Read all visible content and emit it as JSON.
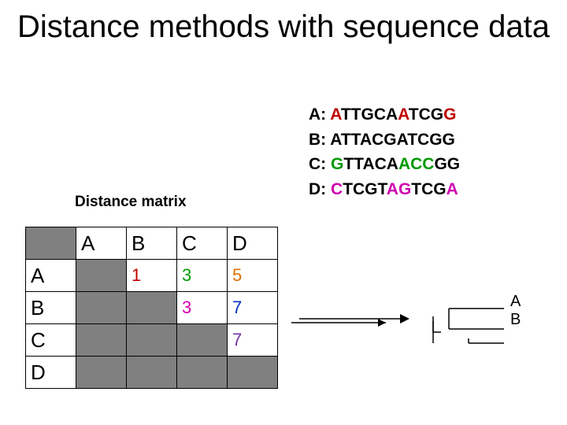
{
  "title": "Distance methods with sequence data",
  "sequences": {
    "A": {
      "label": "A:",
      "pre": "A",
      "mid1": "TTGCA",
      "mut1": "A",
      "post1": "TCG",
      "mut2": "G",
      "post2": ""
    },
    "B": {
      "label": "B:",
      "text": "ATTACGATCGG"
    },
    "C": {
      "label": "C:",
      "pre": "G",
      "mid": "TTACA",
      "mut": "ACC",
      "post": "GG"
    },
    "D": {
      "label": "D:",
      "pre": "C",
      "mid1": "TCGT",
      "mut1": "AG",
      "mid2": "TCG",
      "mut2": "A"
    }
  },
  "matrix_label": "Distance matrix",
  "matrix": {
    "headers": [
      "A",
      "B",
      "C",
      "D"
    ],
    "rows": [
      "A",
      "B",
      "C",
      "D"
    ],
    "cells": {
      "AB": "1",
      "AC": "3",
      "AD": "5",
      "BC": "3",
      "BD": "7",
      "CD": "7"
    }
  },
  "tree_labels": {
    "a": "A",
    "b": "B"
  }
}
